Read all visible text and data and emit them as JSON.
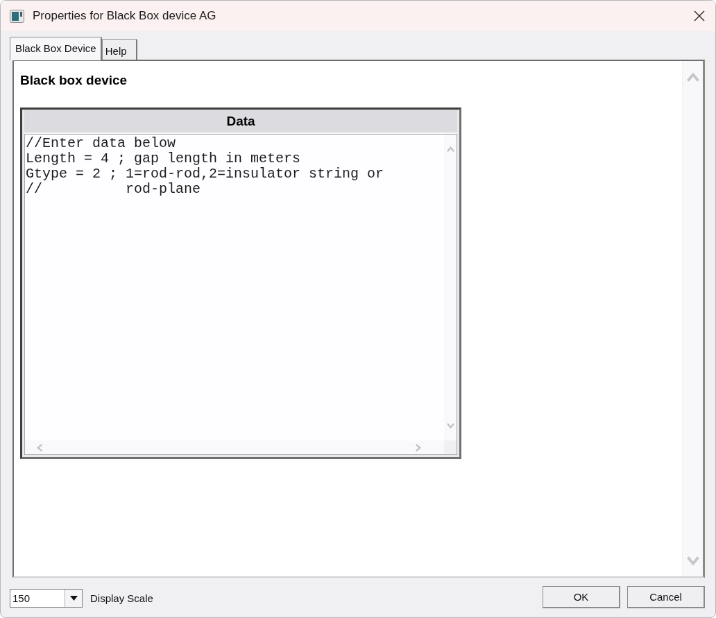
{
  "window": {
    "title": "Properties for Black Box device AG"
  },
  "tabs": [
    {
      "label": "Black Box Device",
      "selected": true
    },
    {
      "label": "Help",
      "selected": false
    }
  ],
  "panel": {
    "heading": "Black box device",
    "data_box": {
      "title": "Data",
      "lines": [
        "//Enter data below",
        "Length = 4 ; gap length in meters",
        "Gtype = 2 ; 1=rod-rod,2=insulator string or",
        "//          rod-plane"
      ]
    }
  },
  "footer": {
    "display_scale": {
      "value": "150",
      "label": "Display Scale"
    },
    "buttons": [
      "OK",
      "Cancel"
    ]
  }
}
